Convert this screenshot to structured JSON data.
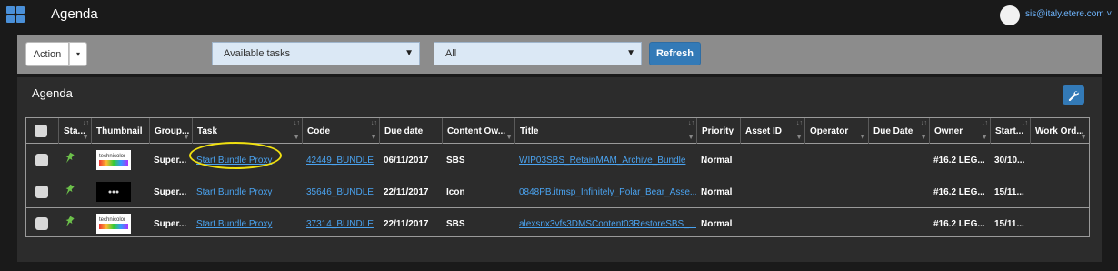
{
  "app": {
    "title": "Agenda",
    "user_email": "sis@italy.etere.com ˅"
  },
  "toolbar": {
    "action_label": "Action",
    "caret": "▾",
    "select1": "Available tasks",
    "select2": "All",
    "refresh_label": "Refresh"
  },
  "panel": {
    "title": "Agenda"
  },
  "table": {
    "headers": [
      "Sta...",
      "Thumbnail",
      "Group...",
      "Task",
      "Code",
      "Due date",
      "Content Ow...",
      "Title",
      "Priority",
      "Asset ID",
      "Operator",
      "Due Date",
      "Owner",
      "Start...",
      "Work Ord..."
    ],
    "rows": [
      {
        "thumb": "technicolor",
        "group": "Super...",
        "task": "Start Bundle Proxy",
        "code": "42449_BUNDLE",
        "due": "06/11/2017",
        "owner_content": "SBS",
        "title": "WIP03SBS_RetainMAM_Archive_Bundle",
        "priority": "Normal",
        "owner": "#16.2 LEG...",
        "start": "30/10..."
      },
      {
        "thumb": "dark",
        "group": "Super...",
        "task": "Start Bundle Proxy",
        "code": "35646_BUNDLE",
        "due": "22/11/2017",
        "owner_content": "Icon",
        "title": "0848PB.itmsp_Infinitely_Polar_Bear_Asse...",
        "priority": "Normal",
        "owner": "#16.2 LEG...",
        "start": "15/11..."
      },
      {
        "thumb": "technicolor",
        "group": "Super...",
        "task": "Start Bundle Proxy",
        "code": "37314_BUNDLE",
        "due": "22/11/2017",
        "owner_content": "SBS",
        "title": "alexsnx3vfs3DMSContent03RestoreSBS_...",
        "priority": "Normal",
        "owner": "#16.2 LEG...",
        "start": "15/11..."
      }
    ]
  },
  "colors": {
    "accent": "#337ab7",
    "link": "#4aa3f0",
    "highlight": "#f0e010",
    "pin": "#6cc04a"
  },
  "icons": {
    "app": "grid-icon",
    "pin": "pin-icon",
    "wrench": "wrench-icon"
  }
}
